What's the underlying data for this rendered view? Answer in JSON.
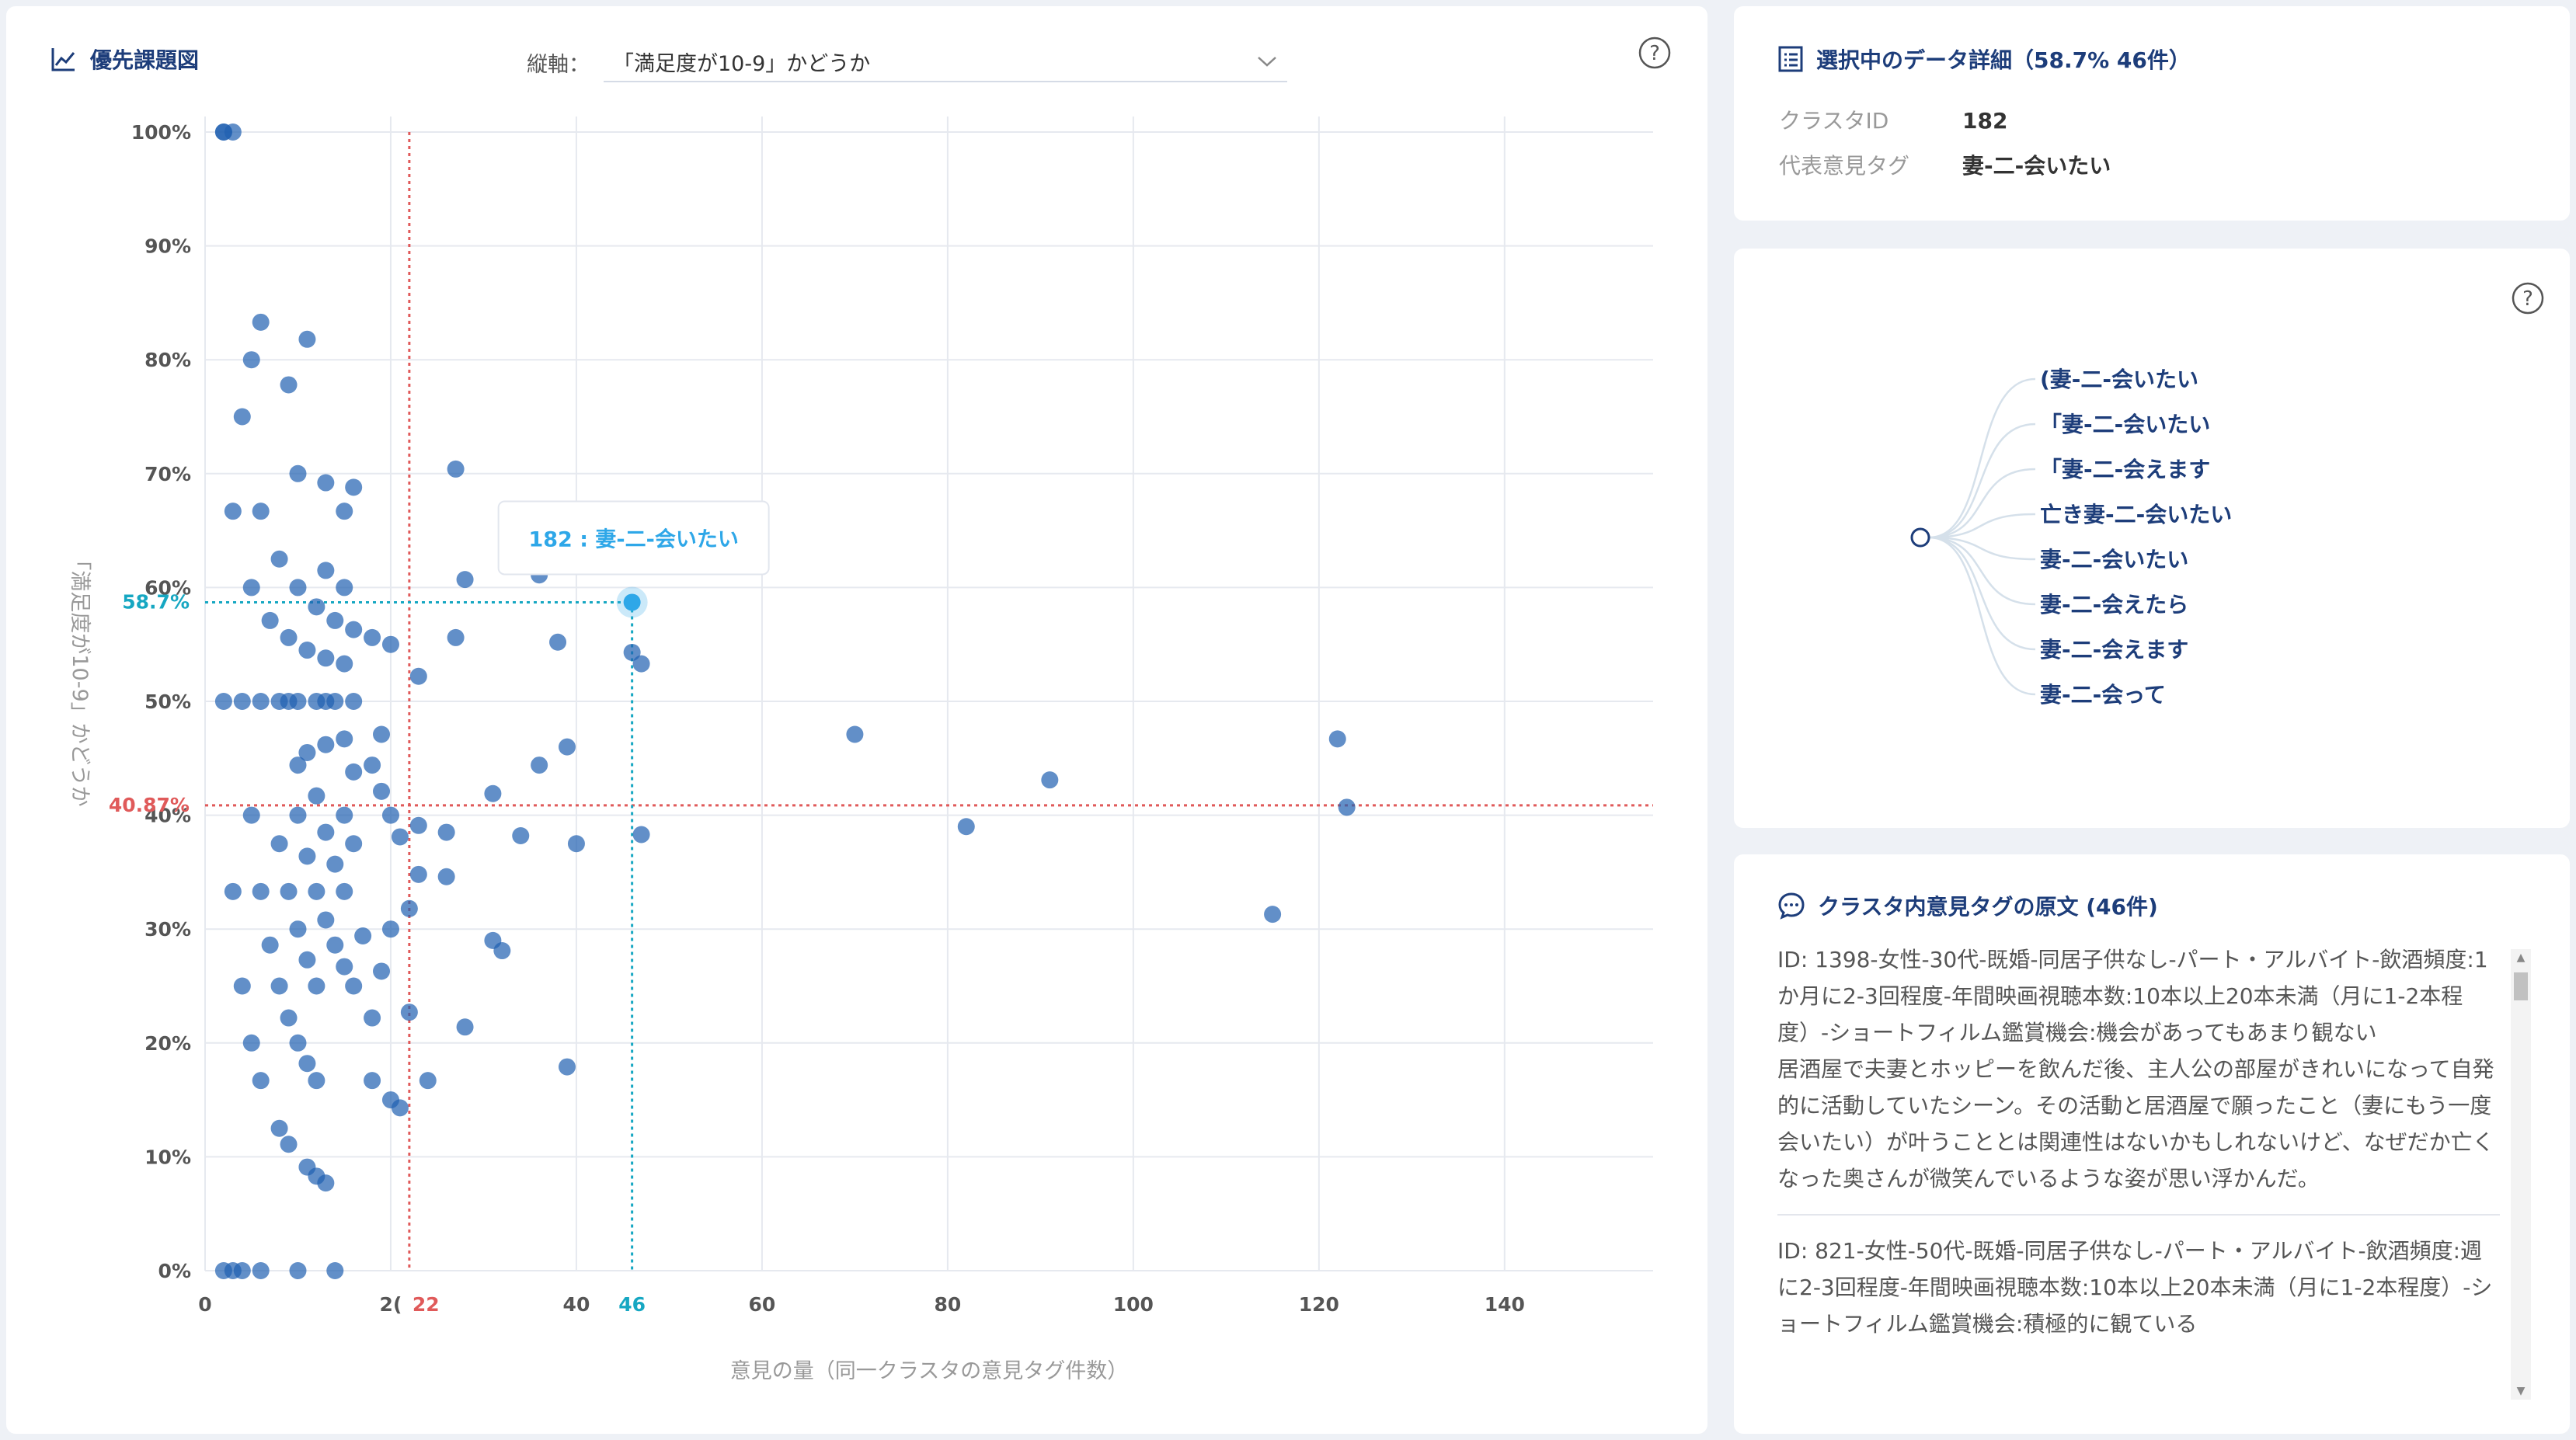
{
  "chart_panel": {
    "title": "優先課題図",
    "axis_selector_label": "縦軸：",
    "axis_selector_value": "「満足度が10-9」かどうか"
  },
  "detail_panel": {
    "title": "選択中のデータ詳細（58.7% 46件）",
    "cluster_id_label": "クラスタID",
    "cluster_id_value": "182",
    "tag_label": "代表意見タグ",
    "tag_value": "妻-二-会いたい"
  },
  "tree_panel": {
    "items": [
      "(妻-二-会いたい",
      "「妻-二-会いたい",
      "「妻-二-会えます",
      "亡き妻-二-会いたい",
      "妻-二-会いたい",
      "妻-二-会えたら",
      "妻-二-会えます",
      "妻-二-会って"
    ]
  },
  "text_panel": {
    "title": "クラスタ内意見タグの原文 (46件)",
    "entries": [
      "ID: 1398-女性-30代-既婚-同居子供なし-パート・アルバイト-飲酒頻度:1か月に2-3回程度-年間映画視聴本数:10本以上20本未満（月に1-2本程度）-ショートフィルム鑑賞機会:機会があってもあまり観ない\n居酒屋で夫妻とホッピーを飲んだ後、主人公の部屋がきれいになって自発的に活動していたシーン。その活動と居酒屋で願ったこと（妻にもう一度会いたい）が叶うこととは関連性はないかもしれないけど、なぜだか亡くなった奥さんが微笑んでいるような姿が思い浮かんだ。",
      "ID: 821-女性-50代-既婚-同居子供なし-パート・アルバイト-飲酒頻度:週に2-3回程度-年間映画視聴本数:10本以上20本未満（月に1-2本程度）-ショートフィルム鑑賞機会:積極的に観ている"
    ]
  },
  "colors": {
    "point": "#1f5fb0",
    "selected": "#2ea7e8",
    "threshold": "#e05a5a",
    "selected_line": "#16a7c2",
    "title": "#1d3d7a"
  },
  "chart_data": {
    "type": "scatter",
    "xlabel": "意見の量（同一クラスタの意見タグ件数）",
    "ylabel": "「満足度が10-9」かどうか",
    "xlim": [
      0,
      156
    ],
    "ylim": [
      0,
      100
    ],
    "xticks": [
      0,
      20,
      40,
      60,
      80,
      100,
      120,
      140
    ],
    "yticks": [
      0,
      10,
      20,
      30,
      40,
      50,
      60,
      70,
      80,
      90,
      100
    ],
    "x_tick_labels": [
      "0",
      "2(",
      "40",
      "",
      "60",
      "80",
      "100",
      "120",
      "140"
    ],
    "y_tick_labels": [
      "0%",
      "10%",
      "20%",
      "30%",
      "40%",
      "50%",
      "60%",
      "70%",
      "80%",
      "90%",
      "100%"
    ],
    "x_threshold": 22,
    "x_threshold_label": "22",
    "y_threshold": 40.87,
    "y_threshold_label": "40.87%",
    "selected": {
      "x": 46,
      "y": 58.7,
      "x_label": "46",
      "y_label": "58.7%",
      "tooltip": "182 : 妻-二-会いたい"
    },
    "points": [
      [
        2,
        100
      ],
      [
        3,
        100
      ],
      [
        2,
        100
      ],
      [
        6,
        83.3
      ],
      [
        11,
        81.8
      ],
      [
        5,
        80
      ],
      [
        9,
        77.8
      ],
      [
        4,
        75
      ],
      [
        10,
        70
      ],
      [
        13,
        69.2
      ],
      [
        16,
        68.8
      ],
      [
        27,
        70.4
      ],
      [
        3,
        66.7
      ],
      [
        6,
        66.7
      ],
      [
        15,
        66.7
      ],
      [
        8,
        62.5
      ],
      [
        13,
        61.5
      ],
      [
        28,
        60.7
      ],
      [
        36,
        61.1
      ],
      [
        5,
        60
      ],
      [
        10,
        60
      ],
      [
        15,
        60
      ],
      [
        12,
        58.3
      ],
      [
        7,
        57.1
      ],
      [
        14,
        57.1
      ],
      [
        16,
        56.3
      ],
      [
        18,
        55.6
      ],
      [
        9,
        55.6
      ],
      [
        27,
        55.6
      ],
      [
        38,
        55.2
      ],
      [
        20,
        55
      ],
      [
        11,
        54.5
      ],
      [
        13,
        53.8
      ],
      [
        15,
        53.3
      ],
      [
        47,
        53.3
      ],
      [
        46,
        54.3
      ],
      [
        23,
        52.2
      ],
      [
        2,
        50
      ],
      [
        4,
        50
      ],
      [
        6,
        50
      ],
      [
        8,
        50
      ],
      [
        9,
        50
      ],
      [
        10,
        50
      ],
      [
        12,
        50
      ],
      [
        13,
        50
      ],
      [
        14,
        50
      ],
      [
        16,
        50
      ],
      [
        70,
        47.1
      ],
      [
        122,
        46.7
      ],
      [
        19,
        47.1
      ],
      [
        15,
        46.7
      ],
      [
        13,
        46.2
      ],
      [
        39,
        46
      ],
      [
        11,
        45.5
      ],
      [
        18,
        44.4
      ],
      [
        36,
        44.4
      ],
      [
        10,
        44.4
      ],
      [
        16,
        43.8
      ],
      [
        91,
        43.1
      ],
      [
        19,
        42.1
      ],
      [
        12,
        41.7
      ],
      [
        31,
        41.9
      ],
      [
        123,
        40.7
      ],
      [
        5,
        40
      ],
      [
        10,
        40
      ],
      [
        15,
        40
      ],
      [
        20,
        40
      ],
      [
        23,
        39.1
      ],
      [
        82,
        39
      ],
      [
        26,
        38.5
      ],
      [
        47,
        38.3
      ],
      [
        34,
        38.2
      ],
      [
        40,
        37.5
      ],
      [
        21,
        38.1
      ],
      [
        16,
        37.5
      ],
      [
        8,
        37.5
      ],
      [
        13,
        38.5
      ],
      [
        11,
        36.4
      ],
      [
        14,
        35.7
      ],
      [
        23,
        34.8
      ],
      [
        26,
        34.6
      ],
      [
        3,
        33.3
      ],
      [
        6,
        33.3
      ],
      [
        9,
        33.3
      ],
      [
        12,
        33.3
      ],
      [
        15,
        33.3
      ],
      [
        22,
        31.8
      ],
      [
        115,
        31.3
      ],
      [
        13,
        30.8
      ],
      [
        10,
        30
      ],
      [
        20,
        30
      ],
      [
        17,
        29.4
      ],
      [
        31,
        29
      ],
      [
        32,
        28.1
      ],
      [
        7,
        28.6
      ],
      [
        14,
        28.6
      ],
      [
        11,
        27.3
      ],
      [
        19,
        26.3
      ],
      [
        15,
        26.7
      ],
      [
        4,
        25
      ],
      [
        8,
        25
      ],
      [
        12,
        25
      ],
      [
        16,
        25
      ],
      [
        22,
        22.7
      ],
      [
        18,
        22.2
      ],
      [
        9,
        22.2
      ],
      [
        28,
        21.4
      ],
      [
        5,
        20
      ],
      [
        10,
        20
      ],
      [
        11,
        18.2
      ],
      [
        39,
        17.9
      ],
      [
        6,
        16.7
      ],
      [
        12,
        16.7
      ],
      [
        18,
        16.7
      ],
      [
        24,
        16.7
      ],
      [
        20,
        15
      ],
      [
        21,
        14.3
      ],
      [
        8,
        12.5
      ],
      [
        9,
        11.1
      ],
      [
        11,
        9.1
      ],
      [
        12,
        8.3
      ],
      [
        13,
        7.7
      ],
      [
        2,
        0
      ],
      [
        3,
        0
      ],
      [
        4,
        0
      ],
      [
        6,
        0
      ],
      [
        10,
        0
      ],
      [
        14,
        0
      ]
    ]
  }
}
